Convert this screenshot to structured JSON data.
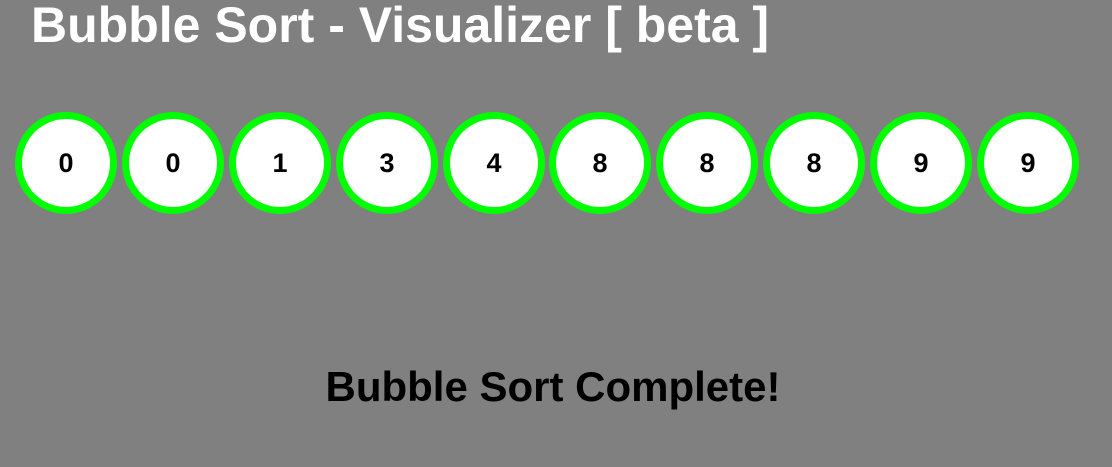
{
  "title": "Bubble Sort - Visualizer [ beta ]",
  "bubbles": [
    {
      "value": "0"
    },
    {
      "value": "0"
    },
    {
      "value": "1"
    },
    {
      "value": "3"
    },
    {
      "value": "4"
    },
    {
      "value": "8"
    },
    {
      "value": "8"
    },
    {
      "value": "8"
    },
    {
      "value": "9"
    },
    {
      "value": "9"
    }
  ],
  "status": "Bubble Sort Complete!",
  "colors": {
    "background": "#808080",
    "bubble_border": "#00ff00",
    "bubble_fill": "#ffffff",
    "title_text": "#ffffff",
    "status_text": "#000000"
  }
}
